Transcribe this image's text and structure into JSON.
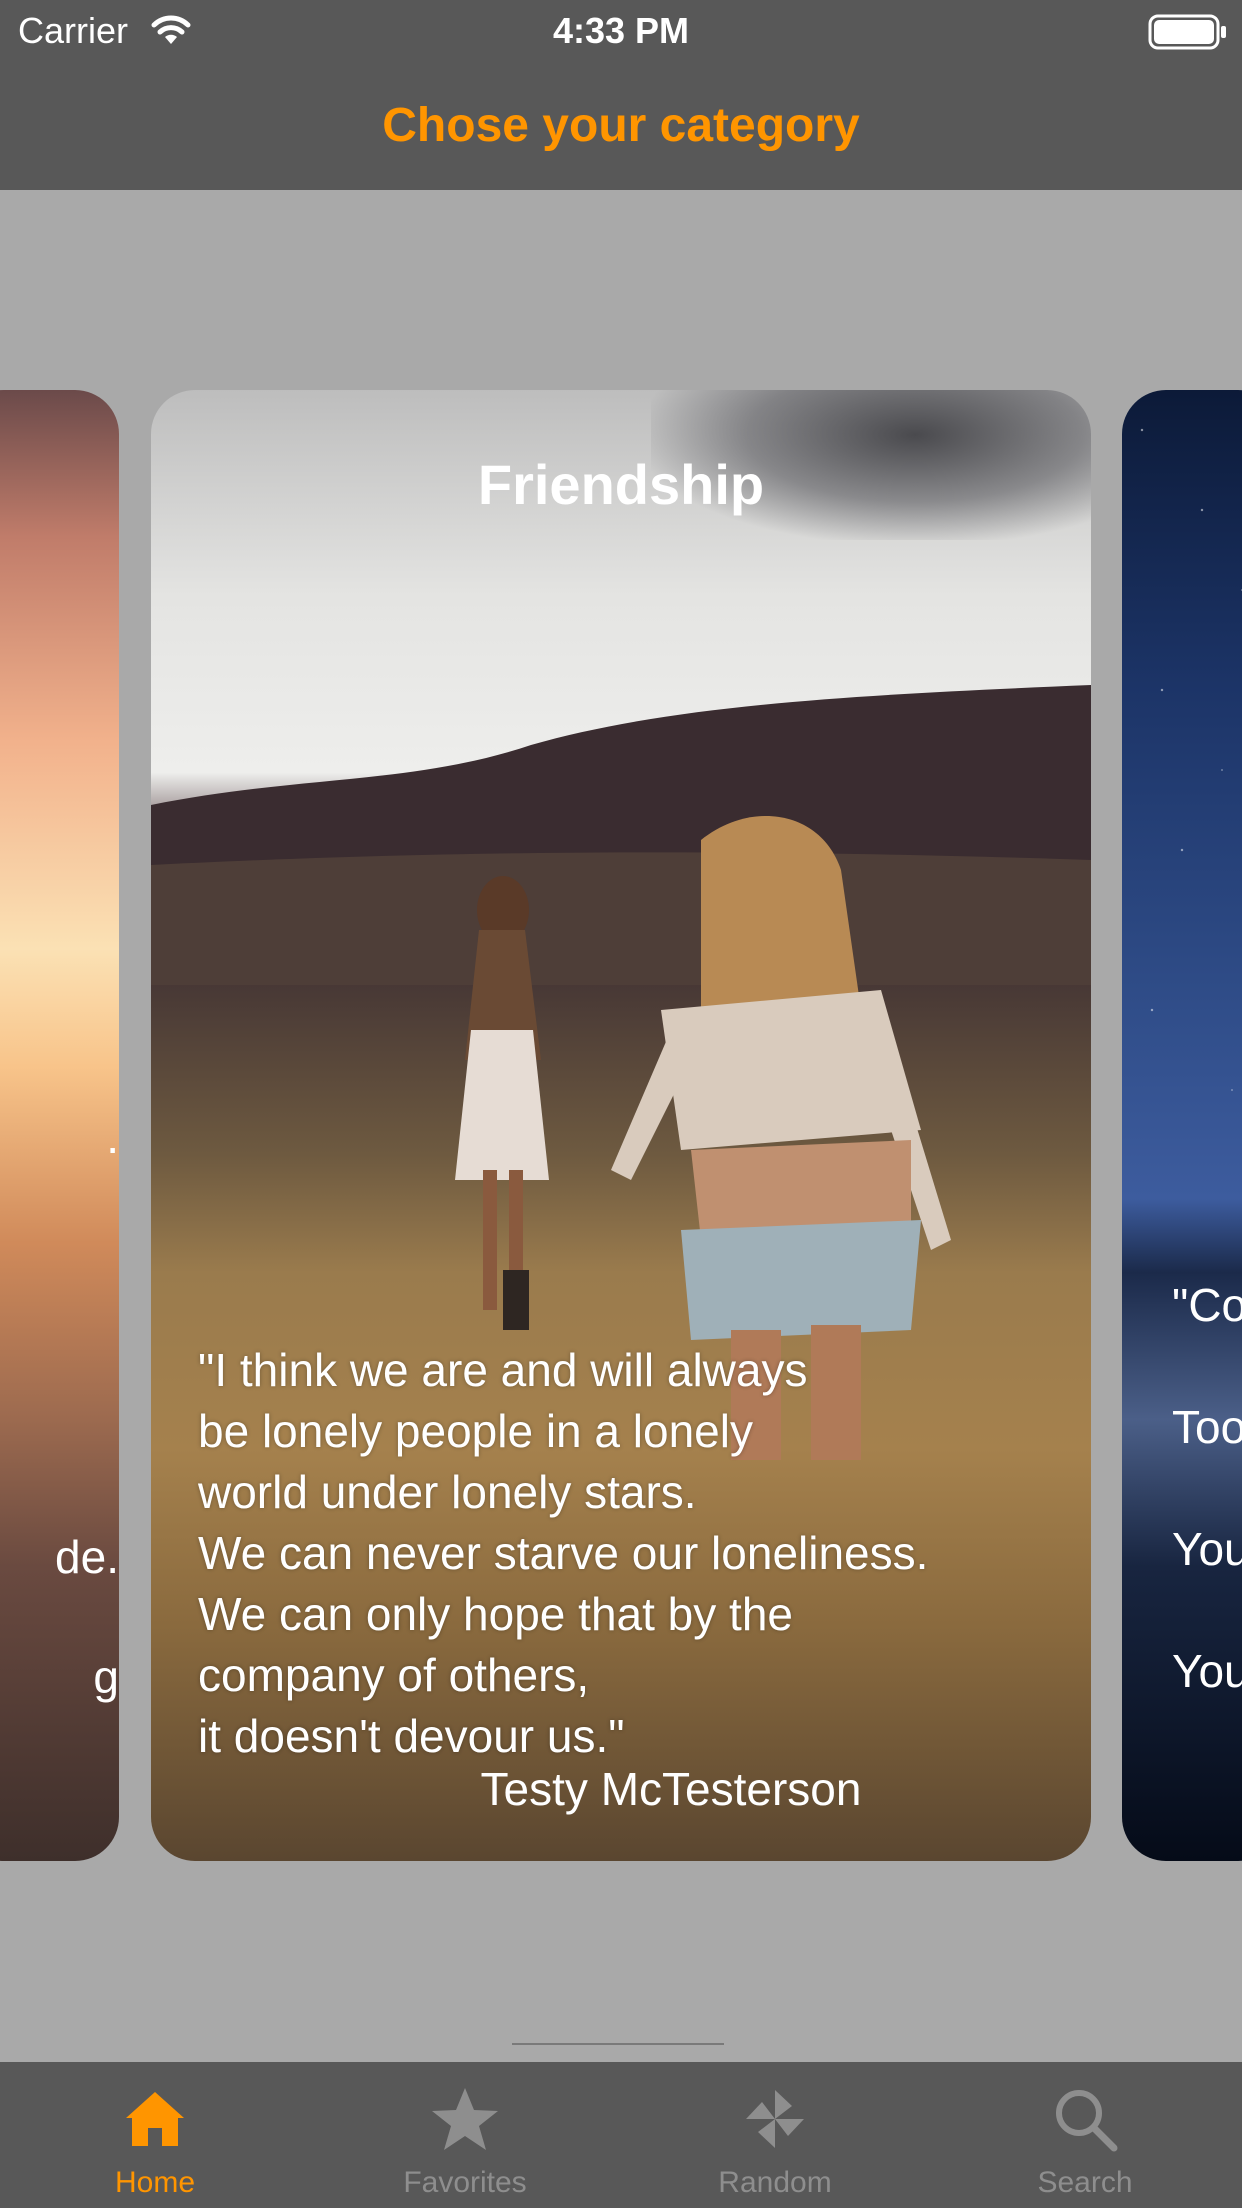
{
  "status_bar": {
    "carrier": "Carrier",
    "time": "4:33 PM"
  },
  "nav": {
    "title": "Chose your category"
  },
  "colors": {
    "accent": "#ff9500",
    "bar_background": "#585858",
    "page_background": "#a9a9a9",
    "inactive_tab": "#8e8e8e"
  },
  "cards": {
    "left": {
      "visible_fragments": [
        ".",
        "de.",
        "g"
      ]
    },
    "current": {
      "title": "Friendship",
      "quote": "\"I think we are and will always\nbe lonely people in a lonely\nworld under lonely stars.\nWe can never starve our loneliness.\nWe can only hope that by the\ncompany of others,\nit doesn't devour us.\"",
      "author": "Testy McTesterson"
    },
    "right": {
      "visible_fragments": [
        "\"Co",
        "Too",
        "You",
        "You"
      ]
    }
  },
  "tabs": [
    {
      "label": "Home",
      "icon": "home-icon",
      "active": true
    },
    {
      "label": "Favorites",
      "icon": "star-icon",
      "active": false
    },
    {
      "label": "Random",
      "icon": "pinwheel-icon",
      "active": false
    },
    {
      "label": "Search",
      "icon": "search-icon",
      "active": false
    }
  ]
}
